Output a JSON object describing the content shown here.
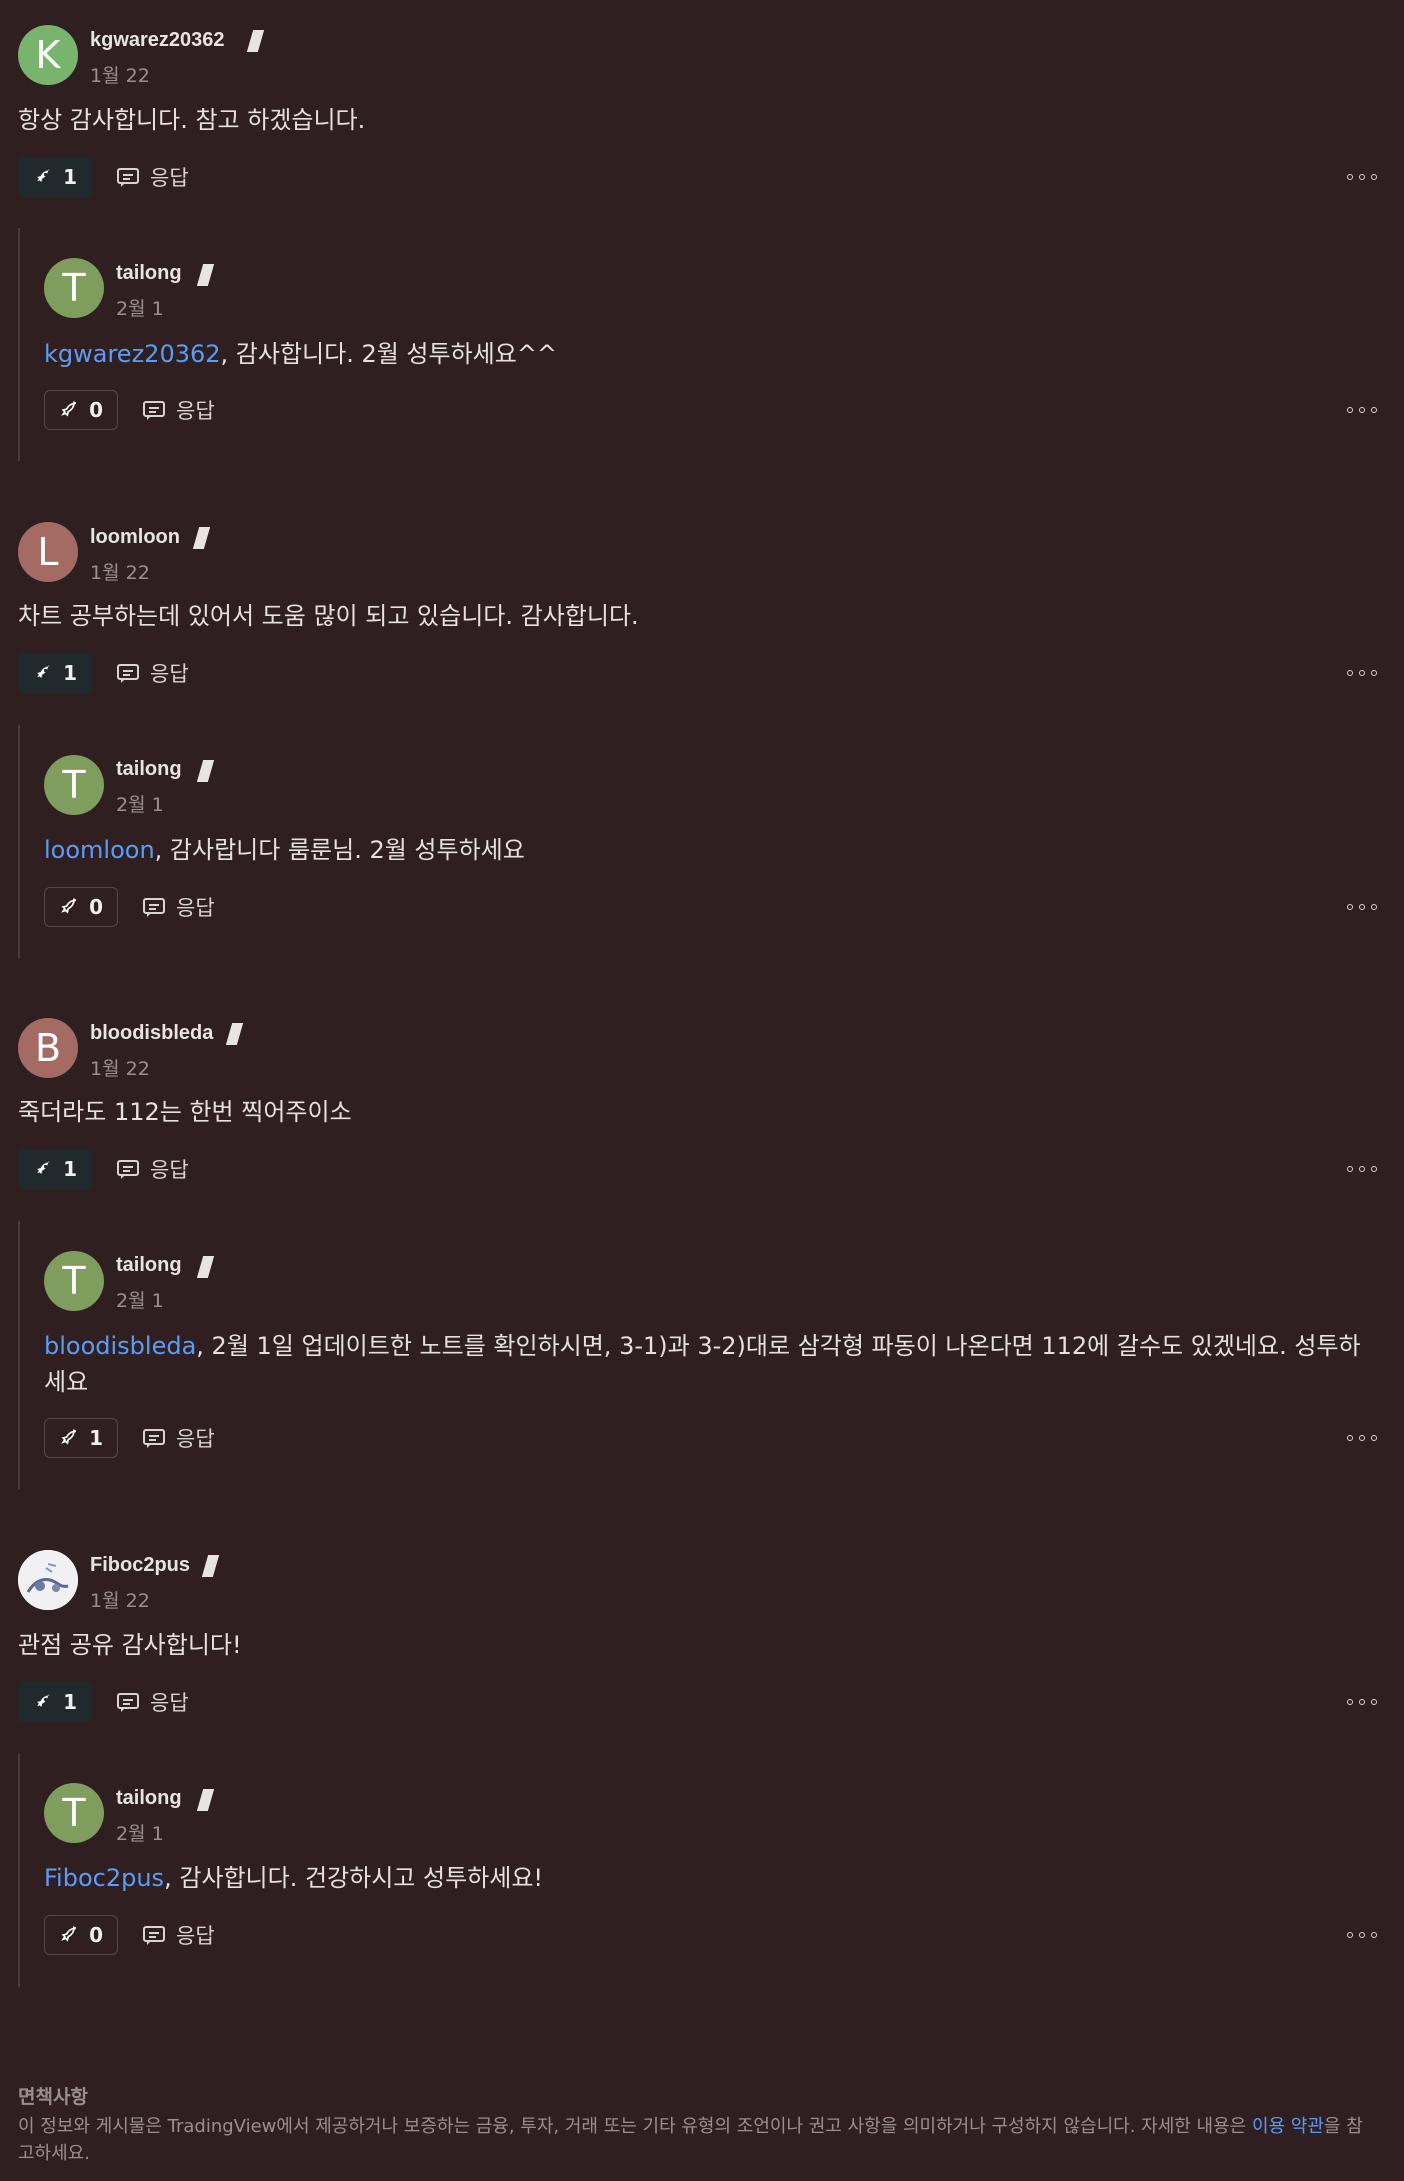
{
  "labels": {
    "reply": "응답",
    "more": "more"
  },
  "colors": {
    "background": "#301f21",
    "mention": "#5b9cf6",
    "avatar_k": "#78b46d",
    "avatar_t": "#7f9d5c",
    "avatar_l": "#a46a64",
    "avatar_b": "#a46a64"
  },
  "threads": [
    {
      "comment": {
        "initial": "K",
        "username": "kgwarez20362",
        "date": "1월 22",
        "text": "항상 감사합니다. 참고 하겠습니다.",
        "boosts": "1"
      },
      "reply": {
        "initial": "T",
        "username": "tailong",
        "date": "2월 1",
        "mention": "kgwarez20362",
        "text": ", 감사합니다. 2월 성투하세요^^",
        "boosts": "0"
      }
    },
    {
      "comment": {
        "initial": "L",
        "username": "loomloon",
        "date": "1월 22",
        "text": "차트 공부하는데 있어서 도움 많이 되고 있습니다. 감사합니다.",
        "boosts": "1"
      },
      "reply": {
        "initial": "T",
        "username": "tailong",
        "date": "2월 1",
        "mention": "loomloon",
        "text": ", 감사랍니다 룸룬님. 2월 성투하세요",
        "boosts": "0"
      }
    },
    {
      "comment": {
        "initial": "B",
        "username": "bloodisbleda",
        "date": "1월 22",
        "text": "죽더라도 112는 한번 찍어주이소",
        "boosts": "1"
      },
      "reply": {
        "initial": "T",
        "username": "tailong",
        "date": "2월 1",
        "mention": "bloodisbleda",
        "text": ", 2월 1일 업데이트한 노트를 확인하시면, 3-1)과 3-2)대로 삼각형 파동이 나온다면 112에 갈수도 있겠네요. 성투하세요",
        "boosts": "1"
      }
    },
    {
      "comment": {
        "initial": "",
        "username": "Fiboc2pus",
        "date": "1월 22",
        "text": "관점 공유 감사합니다!",
        "boosts": "1"
      },
      "reply": {
        "initial": "T",
        "username": "tailong",
        "date": "2월 1",
        "mention": "Fiboc2pus",
        "text": ", 감사합니다. 건강하시고 성투하세요!",
        "boosts": "0"
      }
    }
  ],
  "disclaimer": {
    "title": "면책사항",
    "text_before": "이 정보와 게시물은 TradingView에서 제공하거나 보증하는 금융, 투자, 거래 또는 기타 유형의 조언이나 권고 사항을 의미하거나 구성하지 않습니다. 자세한 내용은 ",
    "link": "이용 약관",
    "text_after": "을 참고하세요."
  }
}
